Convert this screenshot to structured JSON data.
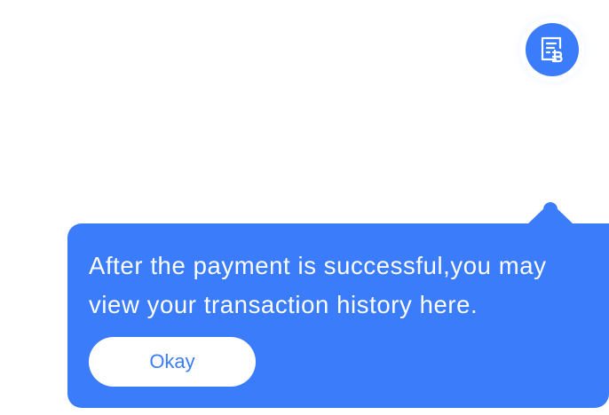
{
  "header": {
    "history_button": {
      "icon": "receipt-baht-icon",
      "background_color": "#3a7cfa"
    }
  },
  "tooltip": {
    "message": "After the payment is successful,you may view your transaction history here.",
    "background_color": "#3a7cfa",
    "okay_label": "Okay"
  }
}
